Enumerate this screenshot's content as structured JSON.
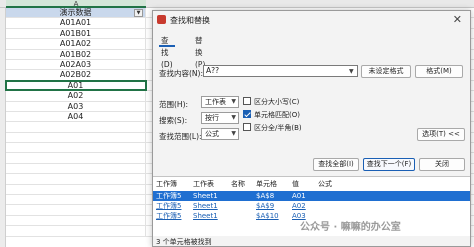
{
  "sheet": {
    "column_letter": "A",
    "header_cell": "演示数据",
    "filter_icon": "▼",
    "rows": [
      "A01A01",
      "A01B01",
      "A01A02",
      "A01B02",
      "A02A03",
      "A02B02",
      "A01",
      "A02",
      "A03",
      "A04",
      "",
      "",
      "",
      "",
      "",
      "",
      "",
      "",
      "",
      "",
      "",
      ""
    ]
  },
  "dialog": {
    "title": "查找和替换",
    "close_icon": "✕",
    "tabs": [
      "查找(D)",
      "替换(P)"
    ],
    "find_label": "查找内容(N):",
    "find_value": "A??",
    "find_dropdown": "▼",
    "no_format_button": "未设定格式",
    "format_button": "格式(M)",
    "range_label": "范围(H):",
    "range_value": "工作表",
    "search_label": "搜索(S):",
    "search_value": "按行",
    "lookin_label": "查找范围(L):",
    "lookin_value": "公式",
    "options": [
      {
        "label": "区分大小写(C)",
        "checked": false
      },
      {
        "label": "单元格匹配(O)",
        "checked": true
      },
      {
        "label": "区分全/半角(B)",
        "checked": false
      }
    ],
    "options_button": "选项(T) <<",
    "find_all_button": "查找全部(I)",
    "find_next_button": "查找下一个(F)",
    "close_button": "关闭",
    "results_headers": [
      "工作簿",
      "工作表",
      "名称",
      "单元格",
      "值",
      "公式"
    ],
    "results": [
      {
        "book": "工作簿5",
        "sheet": "Sheet1",
        "name": "",
        "cell": "$A$8",
        "value": "A01",
        "formula": ""
      },
      {
        "book": "工作簿5",
        "sheet": "Sheet1",
        "name": "",
        "cell": "$A$9",
        "value": "A02",
        "formula": ""
      },
      {
        "book": "工作簿5",
        "sheet": "Sheet1",
        "name": "",
        "cell": "$A$10",
        "value": "A03",
        "formula": ""
      }
    ],
    "status": "3 个单元格被找到"
  },
  "watermark": "公众号 · 嘛嘛的办公室",
  "colors": {
    "accent": "#1a5fb4",
    "excel_green": "#217346",
    "selection": "#1f6fd1"
  }
}
